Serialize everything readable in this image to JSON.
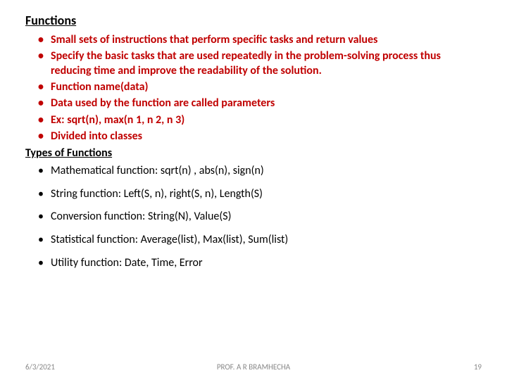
{
  "title": "Functions",
  "bullets1": [
    "Small sets of instructions that perform specific tasks and return values",
    "Specify the basic tasks that are used repeatedly in the problem-solving process thus reducing time and improve the readability of the solution.",
    "Function name(data)",
    "Data used by the function are called parameters",
    "Ex: sqrt(n), max(n 1, n 2, n 3)",
    "Divided into classes"
  ],
  "subheading": "Types of Functions",
  "bullets2": [
    "Mathematical function: sqrt(n) , abs(n), sign(n)",
    "String function: Left(S, n), right(S, n), Length(S)",
    "Conversion function: String(N), Value(S)",
    "Statistical function: Average(list),  Max(list), Sum(list)",
    "Utility function: Date, Time, Error"
  ],
  "footer": {
    "date": "6/3/2021",
    "author": "PROF. A R BRAMHECHA",
    "page": "19"
  }
}
